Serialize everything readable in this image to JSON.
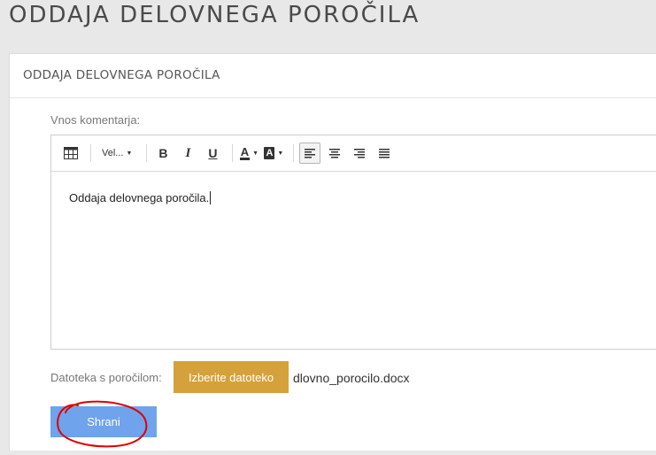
{
  "page": {
    "title": "ODDAJA DELOVNEGA POROČILA"
  },
  "panel": {
    "heading": "ODDAJA DELOVNEGA POROČILA"
  },
  "comment": {
    "label": "Vnos komentarja:",
    "content": "Oddaja delovnega poročila."
  },
  "toolbar": {
    "table_icon": "table-icon",
    "font_size_select": "Vel...",
    "bold_label": "B",
    "italic_label": "I",
    "underline_label": "U",
    "text_color_label": "A",
    "bg_color_label": "A",
    "align_left_icon": "align-left-icon",
    "align_center_icon": "align-center-icon",
    "align_right_icon": "align-right-icon",
    "align_justify_icon": "align-justify-icon",
    "active_alignment": "left"
  },
  "file": {
    "label": "Datoteka s poročilom:",
    "button_label": "Izberite datoteko",
    "selected_name": "dlovno_porocilo.docx"
  },
  "actions": {
    "save_label": "Shrani"
  },
  "colors": {
    "file_button": "#d4a13b",
    "save_button": "#6fa3ec",
    "annotation_circle": "#e00000"
  }
}
